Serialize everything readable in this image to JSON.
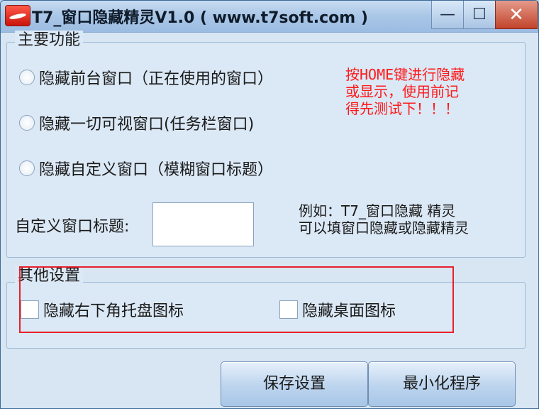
{
  "window": {
    "title": "T7_窗口隐藏精灵V1.0 ( www.t7soft.com )",
    "controls": {
      "minimize": "—",
      "maximize": "☐",
      "close": "✕"
    }
  },
  "main_group": {
    "legend": "主要功能",
    "options": [
      {
        "label": "隐藏前台窗口（正在使用的窗口）",
        "selected": false
      },
      {
        "label": "隐藏一切可视窗口(任务栏窗口)",
        "selected": false
      },
      {
        "label": "隐藏自定义窗口（模糊窗口标题）",
        "selected": false
      }
    ],
    "note": "按HOME键进行隐藏或显示，使用前记得先测试下！！！",
    "custom_title_label": "自定义窗口标题:",
    "custom_title_value": "",
    "example": "例如：T7_窗口隐藏  精灵\n可以填窗口隐藏或隐藏精灵"
  },
  "other_group": {
    "legend": "其他设置",
    "checkboxes": [
      {
        "label": "隐藏右下角托盘图标",
        "checked": false
      },
      {
        "label": "隐藏桌面图标",
        "checked": false
      }
    ]
  },
  "buttons": {
    "save": "保存设置",
    "minimize_program": "最小化程序"
  },
  "colors": {
    "highlight_border": "#e8202a",
    "note_text": "#ff1a1a",
    "close_button": "#c2432b"
  }
}
